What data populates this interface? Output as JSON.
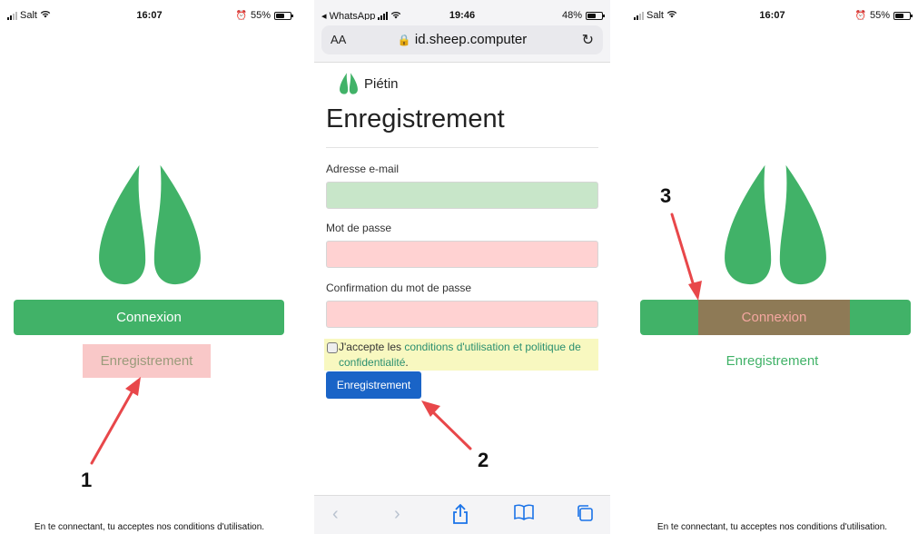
{
  "colors": {
    "brand_green": "#41b268",
    "hoof_green": "#41b268",
    "register_highlight": "#f9c8c8",
    "connexion_highlight": "#8e7a56",
    "email_field": "#c8e6c9",
    "password_field": "#ffd2d2",
    "terms_highlight": "#f8f8c0",
    "submit_blue": "#1a64c7",
    "annotation_red": "#e8474a"
  },
  "screen1": {
    "status": {
      "carrier": "Salt",
      "time": "16:07",
      "battery": "55%"
    },
    "connexion_label": "Connexion",
    "register_label": "Enregistrement",
    "footer": "En te connectant, tu acceptes nos conditions d'utilisation.",
    "marker": "1"
  },
  "screen2": {
    "status": {
      "back_app": "◂ WhatsApp",
      "time": "19:46",
      "battery": "48%"
    },
    "url_aa": "AA",
    "url": "id.sheep.computer",
    "brand": "Piétin",
    "heading": "Enregistrement",
    "email_label": "Adresse e-mail",
    "password_label": "Mot de passe",
    "confirm_label": "Confirmation du mot de passe",
    "terms_prefix": "J'accepte les ",
    "terms_link": "conditions d'utilisation et politique de confidentialité",
    "terms_suffix": ".",
    "submit_label": "Enregistrement",
    "marker": "2"
  },
  "screen3": {
    "status": {
      "carrier": "Salt",
      "time": "16:07",
      "battery": "55%"
    },
    "connexion_label": "Connexion",
    "register_label": "Enregistrement",
    "footer": "En te connectant, tu acceptes nos conditions d'utilisation.",
    "marker": "3"
  }
}
